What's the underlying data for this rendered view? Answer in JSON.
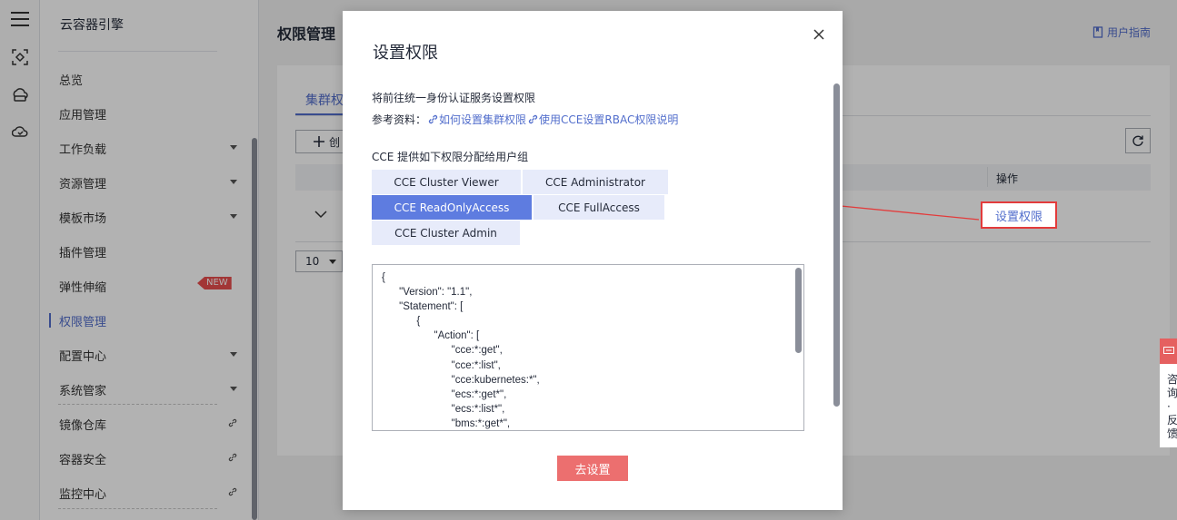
{
  "console": {
    "section_title": "云容器引擎",
    "page_title": "权限管理",
    "user_guide": "用户指南",
    "nav_items": [
      {
        "label": "总览"
      },
      {
        "label": "应用管理"
      },
      {
        "label": "工作负载"
      },
      {
        "label": "资源管理"
      },
      {
        "label": "模板市场"
      },
      {
        "label": "插件管理"
      },
      {
        "label": "弹性伸缩",
        "badge": "NEW"
      },
      {
        "label": "权限管理",
        "active": true
      },
      {
        "label": "配置中心"
      },
      {
        "label": "系统管家"
      },
      {
        "label": "镜像仓库"
      },
      {
        "label": "容器安全"
      },
      {
        "label": "监控中心"
      }
    ],
    "tab_cluster": "集群权",
    "create_label": "创",
    "table_op_header": "操作",
    "row_action": "设置权限",
    "page_size": "10"
  },
  "consult_widget": {
    "text": "咨询·反馈"
  },
  "dialog": {
    "title": "设置权限",
    "intro": "将前往统一身份认证服务设置权限",
    "ref_label": "参考资料：",
    "ref_link1": "如何设置集群权限",
    "ref_link2": "使用CCE设置RBAC权限说明",
    "group_title": "CCE 提供如下权限分配给用户组",
    "permissions": [
      {
        "label": "CCE Cluster Viewer",
        "selected": false
      },
      {
        "label": "CCE Administrator",
        "selected": false
      },
      {
        "label": "CCE ReadOnlyAccess",
        "selected": true
      },
      {
        "label": "CCE FullAccess",
        "selected": false
      },
      {
        "label": "CCE Cluster Admin",
        "selected": false
      }
    ],
    "policy_lines": [
      "{",
      "      \"Version\": \"1.1\",",
      "      \"Statement\": [",
      "            {",
      "                  \"Action\": [",
      "                        \"cce:*:get\",",
      "                        \"cce:*:list\",",
      "                        \"cce:kubernetes:*\",",
      "                        \"ecs:*:get*\",",
      "                        \"ecs:*:list*\",",
      "                        \"bms:*:get*\","
    ],
    "submit_label": "去设置"
  }
}
